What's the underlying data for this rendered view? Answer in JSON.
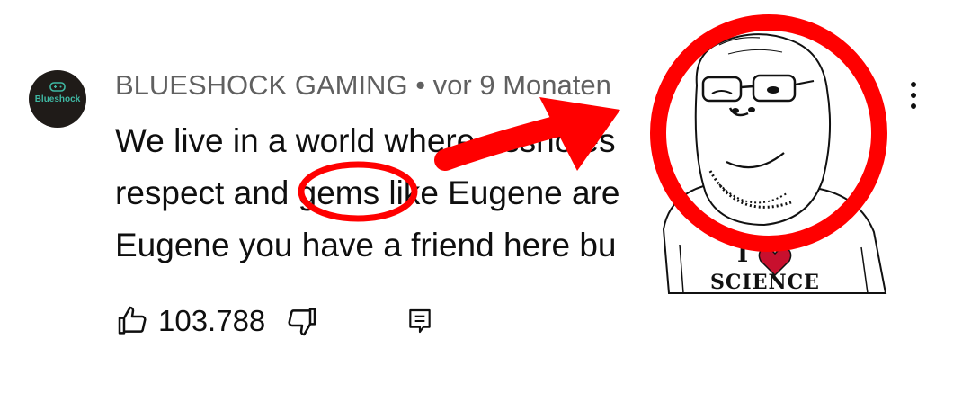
{
  "avatar": {
    "text": "Blueshock",
    "bg": "#1f1b18",
    "accent": "#3fb8a3",
    "icon": "gamepad-icon"
  },
  "comment": {
    "author": "BLUESHOCK GAMING",
    "separator": "•",
    "time": "vor 9 Monaten",
    "lines": [
      "We live in a world where assholes",
      "respect and gems like Eugene are",
      "Eugene you have a friend here bu"
    ],
    "highlighted_word": "gems"
  },
  "actions": {
    "like_count": "103.788",
    "like_icon": "thumbs-up-icon",
    "dislike_icon": "thumbs-down-icon",
    "reply_icon": "reply-icon",
    "more_icon": "more-vertical-icon"
  },
  "meme": {
    "shirt_text_top": "I",
    "shirt_text_bottom": "SCIENCE",
    "heart_color": "#c8102e"
  },
  "annotations": {
    "circle_color": "#ff0000",
    "arrow_color": "#ff0000"
  }
}
